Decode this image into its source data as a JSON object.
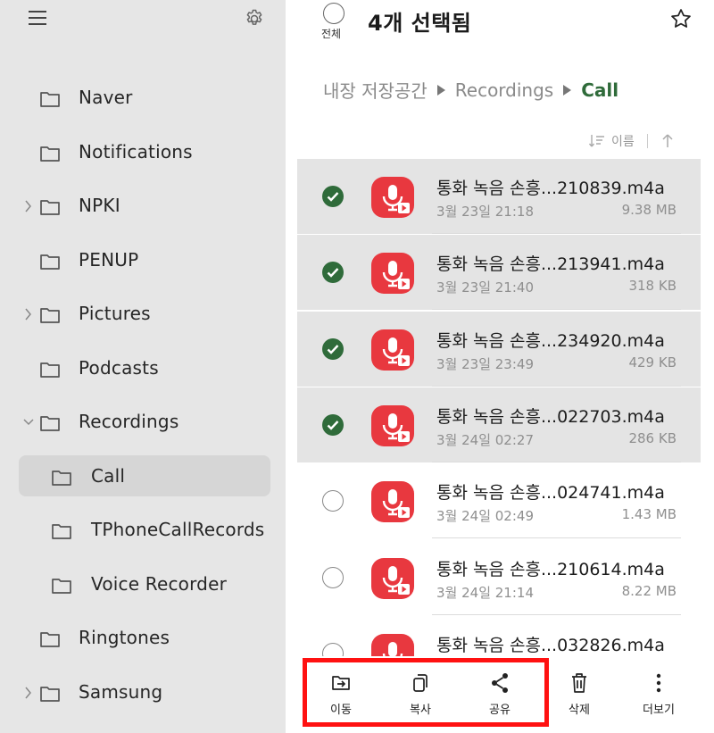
{
  "sidebar": {
    "items": [
      {
        "label": "Naver",
        "level": 0,
        "expandable": false,
        "expanded": false
      },
      {
        "label": "Notifications",
        "level": 0,
        "expandable": false,
        "expanded": false
      },
      {
        "label": "NPKI",
        "level": 0,
        "expandable": true,
        "expanded": false
      },
      {
        "label": "PENUP",
        "level": 0,
        "expandable": false,
        "expanded": false
      },
      {
        "label": "Pictures",
        "level": 0,
        "expandable": true,
        "expanded": false
      },
      {
        "label": "Podcasts",
        "level": 0,
        "expandable": false,
        "expanded": false
      },
      {
        "label": "Recordings",
        "level": 0,
        "expandable": true,
        "expanded": true
      },
      {
        "label": "Call",
        "level": 1,
        "expandable": false,
        "expanded": false,
        "selected": true
      },
      {
        "label": "TPhoneCallRecords",
        "level": 1,
        "expandable": false,
        "expanded": false
      },
      {
        "label": "Voice Recorder",
        "level": 1,
        "expandable": false,
        "expanded": false
      },
      {
        "label": "Ringtones",
        "level": 0,
        "expandable": false,
        "expanded": false
      },
      {
        "label": "Samsung",
        "level": 0,
        "expandable": true,
        "expanded": false
      }
    ]
  },
  "header": {
    "select_all_label": "전체",
    "title": "4개 선택됨"
  },
  "breadcrumb": [
    "내장 저장공간",
    "Recordings",
    "Call"
  ],
  "sort": {
    "label": "이름"
  },
  "files": [
    {
      "name": "통화 녹음 손흥...210839.m4a",
      "date": "3월 23일 21:18",
      "size": "9.38 MB",
      "selected": true
    },
    {
      "name": "통화 녹음 손흥...213941.m4a",
      "date": "3월 23일 21:40",
      "size": "318 KB",
      "selected": true
    },
    {
      "name": "통화 녹음 손흥...234920.m4a",
      "date": "3월 23일 23:49",
      "size": "429 KB",
      "selected": true
    },
    {
      "name": "통화 녹음 손흥...022703.m4a",
      "date": "3월 24일 02:27",
      "size": "286 KB",
      "selected": true
    },
    {
      "name": "통화 녹음 손흥...024741.m4a",
      "date": "3월 24일 02:49",
      "size": "1.43 MB",
      "selected": false
    },
    {
      "name": "통화 녹음 손흥...210614.m4a",
      "date": "3월 24일 21:14",
      "size": "8.22 MB",
      "selected": false
    },
    {
      "name": "통화 녹음 손흥...032826.m4a",
      "date": "",
      "size": "",
      "selected": false
    }
  ],
  "actions": {
    "move": "이동",
    "copy": "복사",
    "share": "공유",
    "delete": "삭제",
    "more": "더보기"
  },
  "colors": {
    "accent_green": "#2f6b3a",
    "app_icon_red": "#e8383f",
    "highlight_red": "#ff1111"
  }
}
